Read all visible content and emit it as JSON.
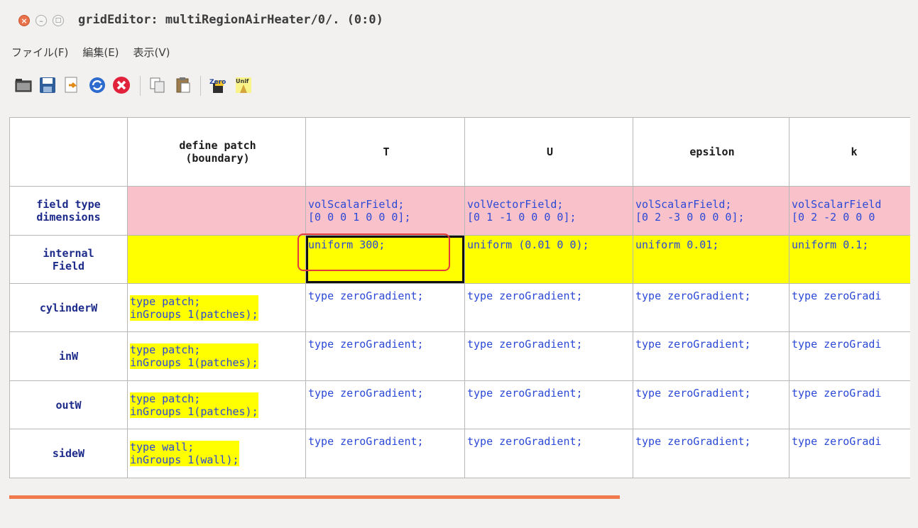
{
  "window": {
    "title": "gridEditor: multiRegionAirHeater/0/. (0:0)"
  },
  "menu": {
    "items": [
      "ファイル(F)",
      "編集(E)",
      "表示(V)"
    ]
  },
  "toolbar": {
    "icons": [
      "folder-open-icon",
      "save-icon",
      "export-icon",
      "refresh-icon",
      "cancel-icon",
      "copy-icon",
      "paste-icon",
      "zero-icon",
      "uniform-icon"
    ],
    "zero_label": "Zero",
    "unif_label": "Unif"
  },
  "grid": {
    "headers": [
      "",
      "define patch\n(boundary)",
      "T",
      "U",
      "epsilon",
      "k"
    ],
    "row_headers": [
      "field type\ndimensions",
      "internal\nField",
      "cylinderW",
      "inW",
      "outW",
      "sideW"
    ],
    "field_type": [
      "",
      "volScalarField;\n[0 0 0 1 0 0 0];",
      "volVectorField;\n[0 1 -1 0 0 0 0];",
      "volScalarField;\n[0 2 -3 0 0 0 0];",
      "volScalarField\n[0 2 -2 0 0 0"
    ],
    "internal_field": [
      "",
      "uniform 300;",
      "uniform (0.01 0 0);",
      "uniform 0.01;",
      "uniform 0.1;"
    ],
    "rows": [
      [
        "type patch;\ninGroups 1(patches);",
        "type zeroGradient;",
        "type zeroGradient;",
        "type zeroGradient;",
        "type zeroGradi"
      ],
      [
        "type patch;\ninGroups 1(patches);",
        "type zeroGradient;",
        "type zeroGradient;",
        "type zeroGradient;",
        "type zeroGradi"
      ],
      [
        "type patch;\ninGroups 1(patches);",
        "type zeroGradient;",
        "type zeroGradient;",
        "type zeroGradient;",
        "type zeroGradi"
      ],
      [
        "type wall;\ninGroups 1(wall);",
        "type zeroGradient;",
        "type zeroGradient;",
        "type zeroGradient;",
        "type zeroGradi"
      ]
    ]
  },
  "colors": {
    "pink": "#f9c2cb",
    "yellow": "#ffff00",
    "selection_highlight": "#e33b3b",
    "scrollbar": "#f07a4c"
  }
}
